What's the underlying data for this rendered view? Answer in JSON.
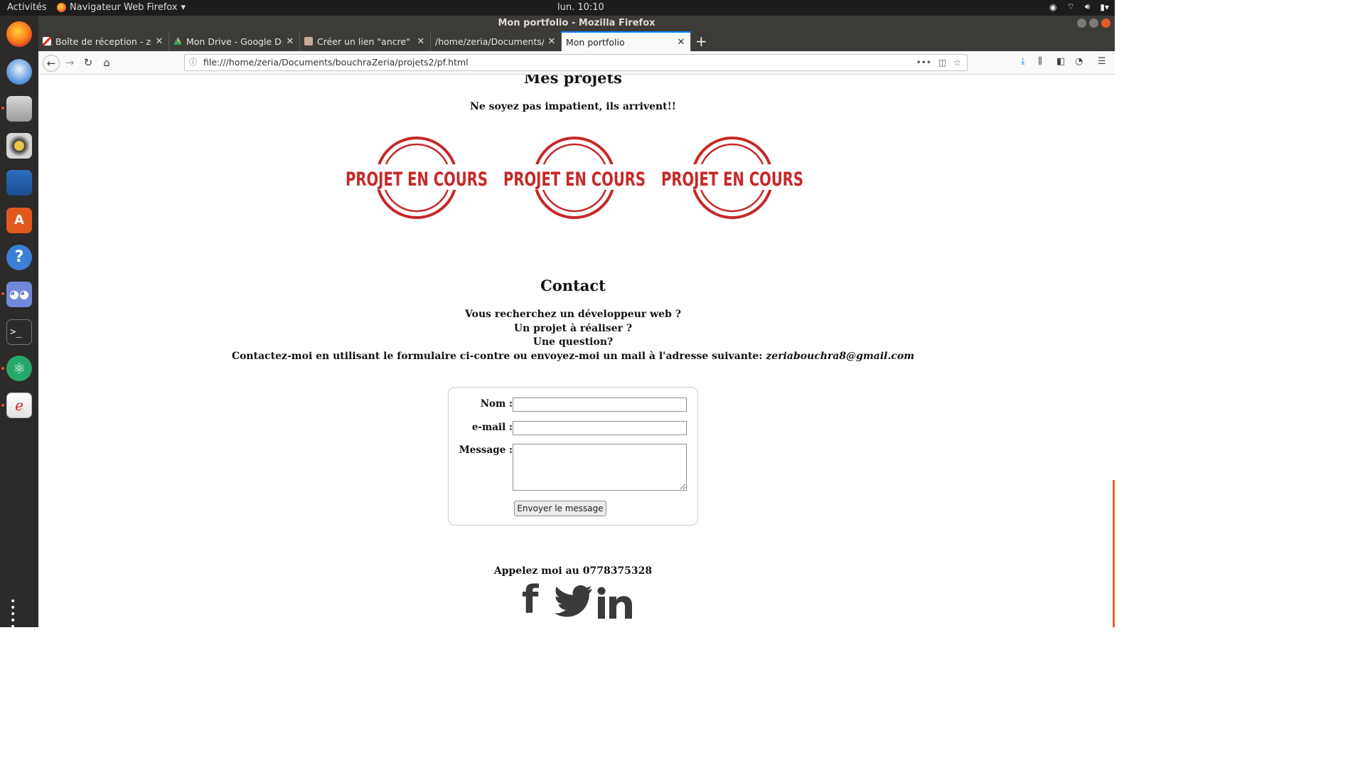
{
  "system": {
    "activities": "Activités",
    "app_menu": "Navigateur Web Firefox",
    "clock": "lun. 10:10"
  },
  "window": {
    "title": "Mon portfolio - Mozilla Firefox"
  },
  "tabs": [
    {
      "label": "Boîte de réception - zeria",
      "icon": "gmail-icon",
      "active": false
    },
    {
      "label": "Mon Drive - Google Drive",
      "icon": "google-drive-icon",
      "active": false
    },
    {
      "label": "Créer un lien \"ancre\" au s",
      "icon": "page-icon",
      "active": false
    },
    {
      "label": "/home/zeria/Documents/bo",
      "icon": "folder-icon",
      "active": false
    },
    {
      "label": "Mon portfolio",
      "icon": "",
      "active": true
    }
  ],
  "address_bar": {
    "url": "file:///home/zeria/Documents/bouchraZeria/projets2/pf.html"
  },
  "page": {
    "projects": {
      "heading": "Mes projets",
      "subtitle": "Ne soyez pas impatient, ils arrivent!!",
      "stamp_text": "PROJET EN COURS",
      "stamp_count": 3
    },
    "contact": {
      "heading": "Contact",
      "line1": "Vous recherchez un développeur web ?",
      "line2": "Un projet à réaliser ?",
      "line3": "Une question?",
      "line4": "Contactez-moi en utilisant le formulaire ci-contre ou envoyez-moi un mail à l'adresse suivante:",
      "email": "zeriabouchra8@gmail.com"
    },
    "form": {
      "name_label": "Nom :",
      "email_label": "e-mail :",
      "message_label": "Message :",
      "name_value": "",
      "email_value": "",
      "message_value": "",
      "submit_label": "Envoyer le message"
    },
    "footer": {
      "phone": "Appelez moi au 0778375328",
      "social": [
        "facebook-icon",
        "twitter-icon",
        "linkedin-icon"
      ]
    }
  },
  "colors": {
    "stamp_red": "#c62828",
    "ubuntu_orange": "#e95420",
    "firefox_blue": "#0a84ff"
  }
}
